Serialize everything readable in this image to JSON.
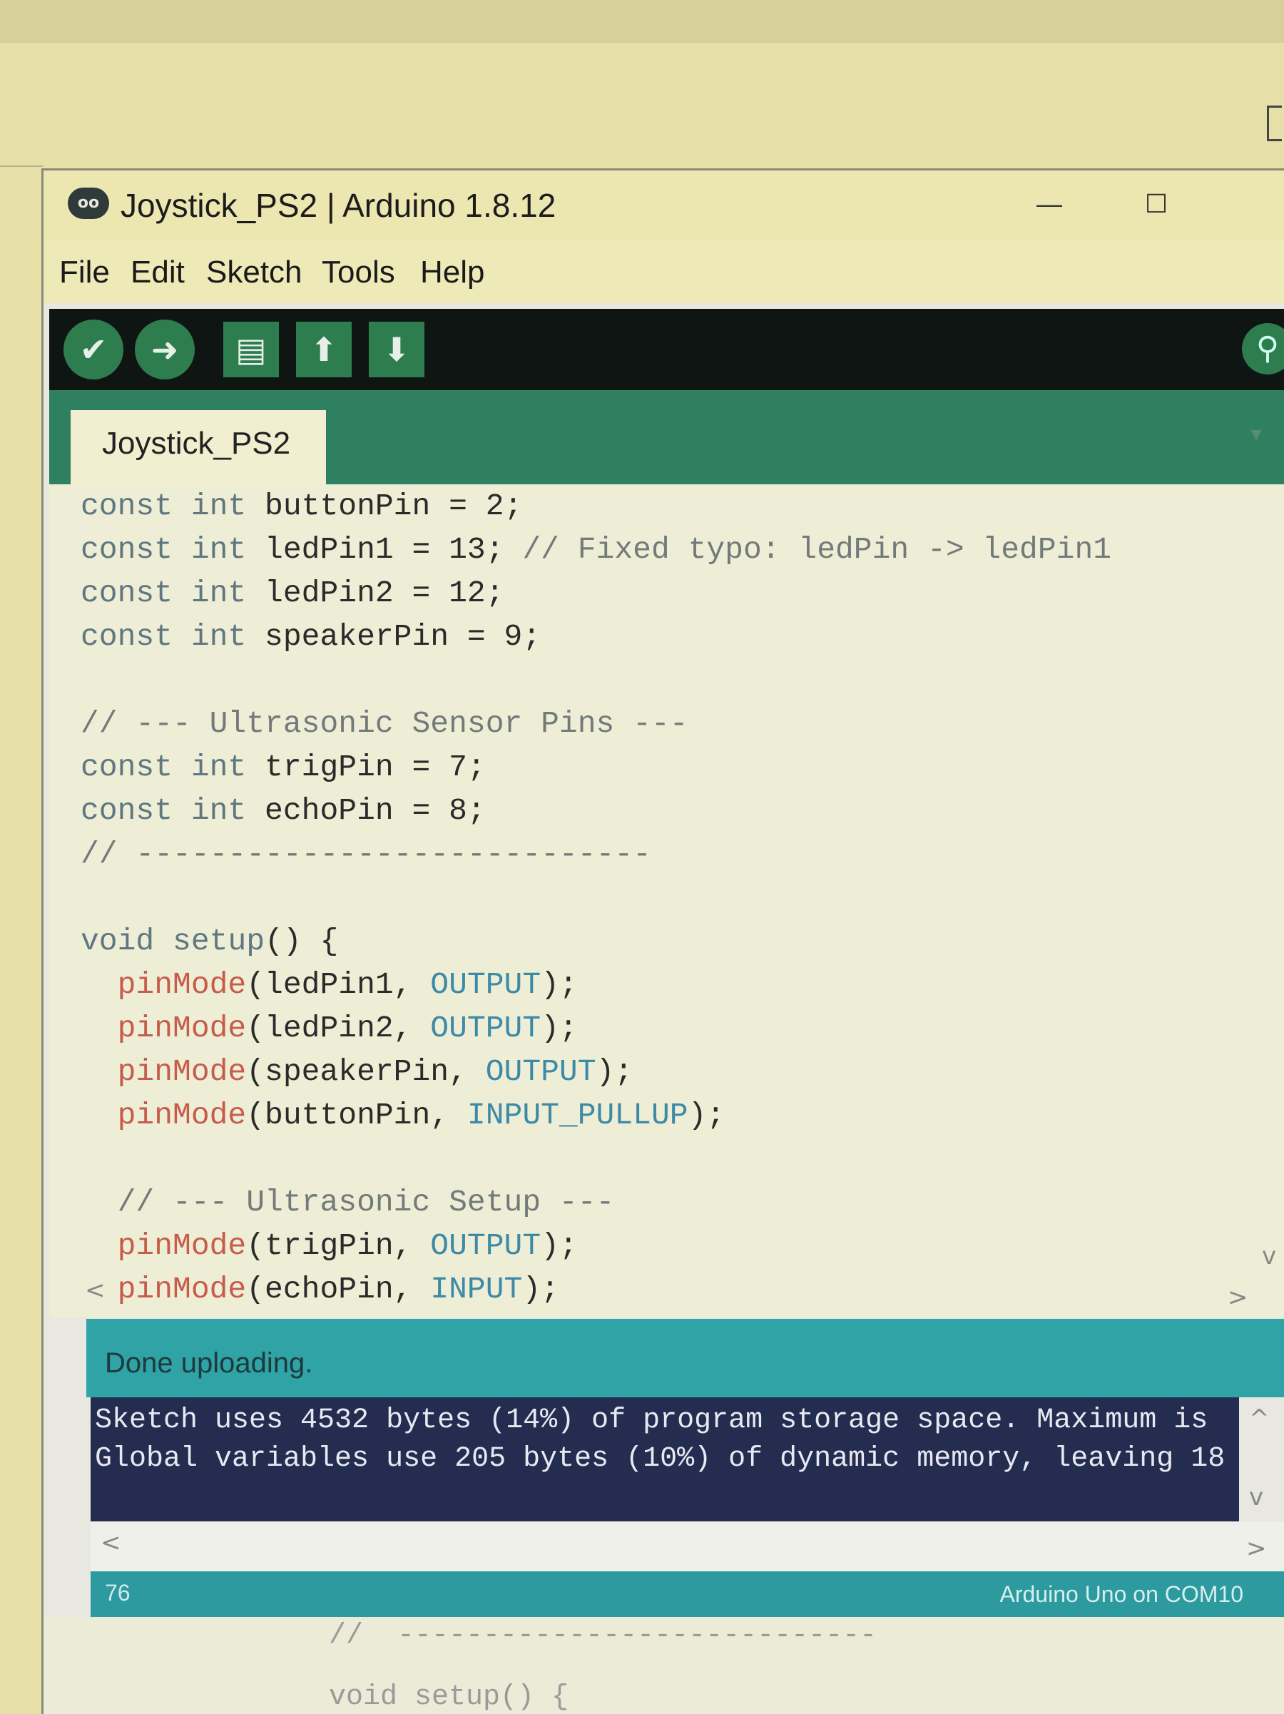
{
  "window": {
    "title": "Joystick_PS2 | Arduino 1.8.12",
    "logo_text": "oo",
    "minimize_glyph": "—",
    "maximize_glyph": "☐"
  },
  "menu": [
    "File",
    "Edit",
    "Sketch",
    "Tools",
    "Help"
  ],
  "toolbar": {
    "verify_icon": "check-icon",
    "upload_icon": "arrow-right-icon",
    "new_icon": "new-file-icon",
    "open_icon": "arrow-up-icon",
    "save_icon": "arrow-down-icon",
    "serial_monitor_icon": "magnifier-icon"
  },
  "tab": {
    "label": "Joystick_PS2",
    "menu_glyph": "▾"
  },
  "code_lines": [
    [
      {
        "t": "const int",
        "c": "kw"
      },
      {
        "t": " buttonPin = 2;"
      }
    ],
    [
      {
        "t": "const int",
        "c": "kw"
      },
      {
        "t": " ledPin1 = 13; "
      },
      {
        "t": "// Fixed typo: ledPin -> ledPin1",
        "c": "cm"
      }
    ],
    [
      {
        "t": "const int",
        "c": "kw"
      },
      {
        "t": " ledPin2 = 12;"
      }
    ],
    [
      {
        "t": "const int",
        "c": "kw"
      },
      {
        "t": " speakerPin = 9;"
      }
    ],
    [],
    [
      {
        "t": "// --- Ultrasonic Sensor Pins ---",
        "c": "cm"
      }
    ],
    [
      {
        "t": "const int",
        "c": "kw"
      },
      {
        "t": " trigPin = 7;"
      }
    ],
    [
      {
        "t": "const int",
        "c": "kw"
      },
      {
        "t": " echoPin = 8;"
      }
    ],
    [
      {
        "t": "// ----------------------------",
        "c": "cm"
      }
    ],
    [],
    [
      {
        "t": "void",
        "c": "kw"
      },
      {
        "t": " "
      },
      {
        "t": "setup",
        "c": "kw"
      },
      {
        "t": "() {"
      }
    ],
    [
      {
        "t": "  "
      },
      {
        "t": "pinMode",
        "c": "fn"
      },
      {
        "t": "(ledPin1, "
      },
      {
        "t": "OUTPUT",
        "c": "ct"
      },
      {
        "t": ");"
      }
    ],
    [
      {
        "t": "  "
      },
      {
        "t": "pinMode",
        "c": "fn"
      },
      {
        "t": "(ledPin2, "
      },
      {
        "t": "OUTPUT",
        "c": "ct"
      },
      {
        "t": ");"
      }
    ],
    [
      {
        "t": "  "
      },
      {
        "t": "pinMode",
        "c": "fn"
      },
      {
        "t": "(speakerPin, "
      },
      {
        "t": "OUTPUT",
        "c": "ct"
      },
      {
        "t": ");"
      }
    ],
    [
      {
        "t": "  "
      },
      {
        "t": "pinMode",
        "c": "fn"
      },
      {
        "t": "(buttonPin, "
      },
      {
        "t": "INPUT_PULLUP",
        "c": "ct"
      },
      {
        "t": ");"
      }
    ],
    [],
    [
      {
        "t": "  "
      },
      {
        "t": "// --- Ultrasonic Setup ---",
        "c": "cm"
      }
    ],
    [
      {
        "t": "  "
      },
      {
        "t": "pinMode",
        "c": "fn"
      },
      {
        "t": "(trigPin, "
      },
      {
        "t": "OUTPUT",
        "c": "ct"
      },
      {
        "t": ");"
      }
    ],
    [
      {
        "t": "  "
      },
      {
        "t": "pinMode",
        "c": "fn"
      },
      {
        "t": "(echoPin, "
      },
      {
        "t": "INPUT",
        "c": "ct"
      },
      {
        "t": ");"
      }
    ]
  ],
  "status": {
    "message": "Done uploading."
  },
  "console": {
    "lines": [
      "Sketch uses 4532 bytes (14%) of program storage space. Maximum is",
      "Global variables use 205 bytes (10%) of dynamic memory, leaving 18"
    ]
  },
  "footer": {
    "line_number": "76",
    "board": "Arduino Uno on COM10"
  },
  "underlay_lines": [
    "//  ----------------------------",
    "void setup() {"
  ],
  "scroll_glyphs": {
    "left": "<",
    "right": ">",
    "up": "^",
    "down": "v"
  }
}
